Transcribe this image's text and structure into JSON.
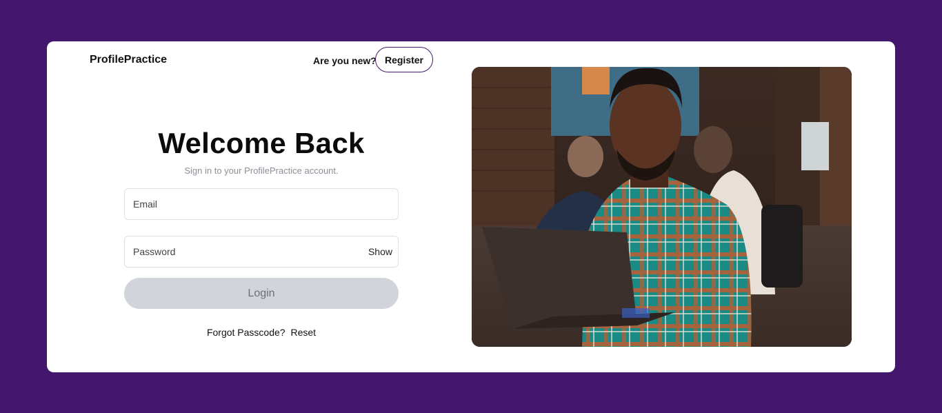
{
  "app": {
    "brand": "ProfilePractice"
  },
  "header": {
    "new_prompt": "Are you new?",
    "register_label": "Register"
  },
  "login": {
    "title": "Welcome Back",
    "subtitle": "Sign in to your ProfilePractice account.",
    "email": {
      "placeholder": "Email",
      "value": ""
    },
    "password": {
      "placeholder": "Password",
      "value": "",
      "toggle_label": "Show"
    },
    "submit_label": "Login",
    "forgot_prompt": "Forgot Passcode?",
    "reset_label": "Reset"
  },
  "hero_image": {
    "subject": "man in plaid shirt holding laptop in office"
  },
  "colors": {
    "background": "#43186c",
    "card": "#ffffff",
    "accent": "#43186c",
    "button_disabled": "#d2d4db"
  }
}
